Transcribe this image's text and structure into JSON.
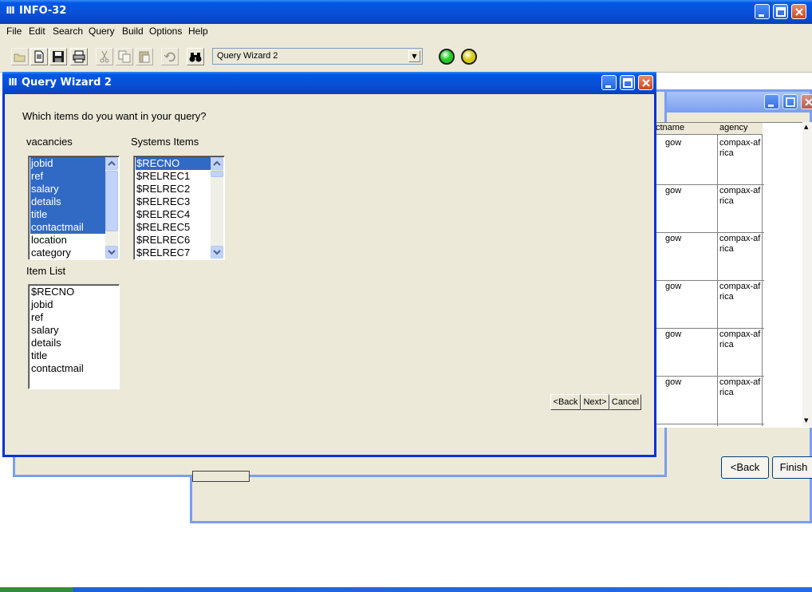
{
  "app": {
    "title": "INFO-32"
  },
  "menu": [
    "File",
    "Edit",
    "Search",
    "Query",
    "Build",
    "Options",
    "Help"
  ],
  "toolbar": {
    "query_select": "Query Wizard 2",
    "icons": [
      "open-folder-icon",
      "new-document-icon",
      "save-disk-icon",
      "print-icon",
      "cut-icon",
      "copy-icon",
      "paste-icon",
      "undo-icon",
      "find-binoculars-icon"
    ],
    "status_lights": [
      "#22cc22",
      "#d8cc10"
    ]
  },
  "background_window": {
    "columns": [
      "ctname",
      "agency"
    ],
    "rows": [
      {
        "c1": "gow",
        "c2a": "compax-af",
        "c2b": "rica"
      },
      {
        "c1": "gow",
        "c2a": "compax-af",
        "c2b": "rica"
      },
      {
        "c1": "gow",
        "c2a": "compax-af",
        "c2b": "rica"
      },
      {
        "c1": "gow",
        "c2a": "compax-af",
        "c2b": "rica"
      },
      {
        "c1": "gow",
        "c2a": "compax-af",
        "c2b": "rica"
      },
      {
        "c1": "gow",
        "c2a": "compax-af",
        "c2b": "rica"
      }
    ],
    "back_label": "<Back",
    "finish_label": "Finish"
  },
  "wizard": {
    "title": "Query Wizard 2",
    "prompt": "Which items do you want in your query?",
    "vacancies_label": "vacancies",
    "systems_label": "Systems Items",
    "item_list_label": "Item List",
    "vacancies_items": [
      "jobid",
      "ref",
      "salary",
      "details",
      "title",
      "contactmail",
      "location",
      "category"
    ],
    "systems_items": [
      "$RECNO",
      "$RELREC1",
      "$RELREC2",
      "$RELREC3",
      "$RELREC4",
      "$RELREC5",
      "$RELREC6",
      "$RELREC7"
    ],
    "item_list": [
      "$RECNO",
      "jobid",
      "ref",
      "salary",
      "details",
      "title",
      "contactmail"
    ],
    "back_label": "<Back",
    "next_label": "Next>",
    "cancel_label": "Cancel"
  },
  "colors": {
    "selection": "#316ac5",
    "titlebar": "#0a4fd6",
    "dialog_bg": "#ece9d8"
  }
}
